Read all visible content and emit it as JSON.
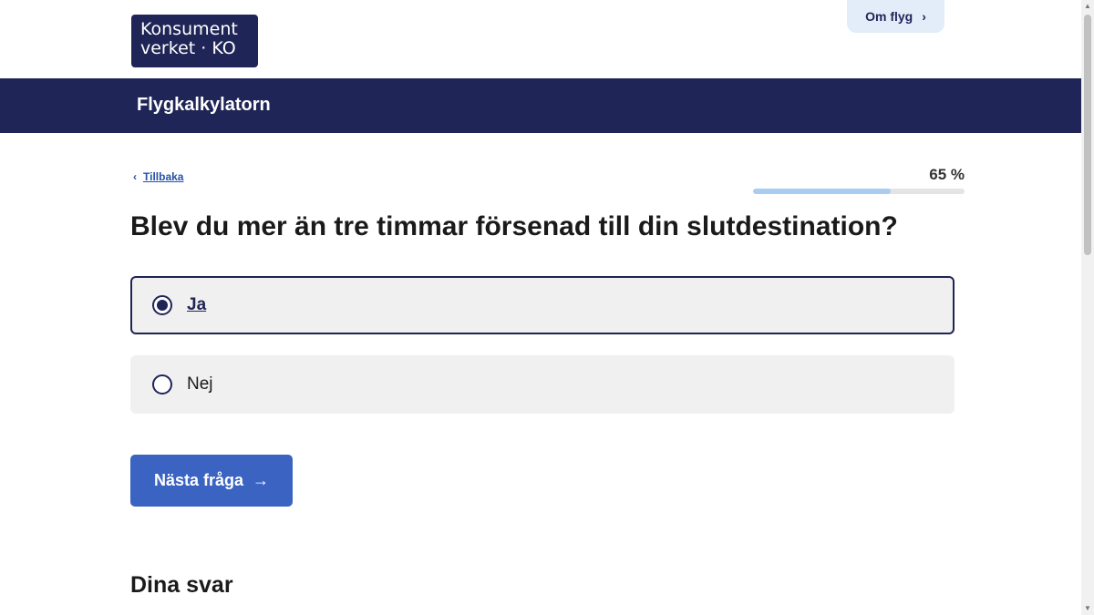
{
  "header": {
    "logo": {
      "line1": "Konsument",
      "line2": "verket · KO"
    },
    "about_link": {
      "label": "Om flyg",
      "icon": "chevron-right-icon",
      "glyph": "›"
    }
  },
  "banner": {
    "title": "Flygkalkylatorn"
  },
  "nav": {
    "back_label": "Tillbaka",
    "back_glyph": "‹"
  },
  "progress": {
    "label": "65 %",
    "value_percent": 65
  },
  "question": {
    "text": "Blev du mer än tre timmar försenad till din slutdestination?",
    "options": [
      {
        "label": "Ja",
        "selected": true
      },
      {
        "label": "Nej",
        "selected": false
      }
    ]
  },
  "actions": {
    "next_label": "Nästa fråga",
    "next_glyph": "→"
  },
  "answers": {
    "heading": "Dina svar"
  },
  "colors": {
    "brand_navy": "#1f2556",
    "button_blue": "#3a63c2",
    "progress_fill": "#a8cdf0",
    "option_bg": "#f0f0f0",
    "link_blue": "#2451a8"
  }
}
